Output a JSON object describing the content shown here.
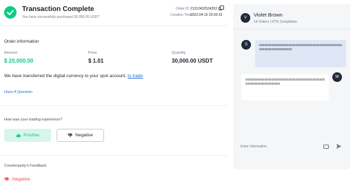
{
  "header": {
    "title": "Transaction Complete",
    "subtitle": "You have successfully purchased 30,000.00 USDT",
    "order_id_label": "Order ID",
    "order_id": "21312432524353",
    "creation_time_label": "Creation Time",
    "creation_time": "2022-04-15 20:30:15"
  },
  "order": {
    "section_title": "Order information",
    "amount_label": "Amount",
    "amount": "$ 20,000.00",
    "price_label": "Price",
    "price": "$ 1.01",
    "quantity_label": "Quantity",
    "quantity": "30,000.00 USDT",
    "transfer_text": "We have transferred the digital currency to your spot account,",
    "transfer_link": "to trade",
    "question_link": "Have A Question"
  },
  "feedback": {
    "question": "How was your trading experience?",
    "positive_label": "Positive",
    "negative_label": "Negative",
    "counterparty_title": "Counterparty's Feedback",
    "counterparty_value": "Negative"
  },
  "chat": {
    "avatar_letter": "V",
    "name": "Violet Brown",
    "stats": "14 Orders  |  97% Completion",
    "incoming_avatar": "S",
    "incoming_text": "xxxxxxxxxxxxxxxxxxxxxxxxxxxxxxxxxxxxxxxxxxxxxxxxxxxxxxxxxxxxxxxxxxx",
    "outgoing_avatar": "W",
    "outgoing_text": "xxxxxxxxxxxxxxxxxxxxxxxxxxxxxxxxxxxxxxxxxxxxxxxxxxxxxxxxxxxxxxxxxx",
    "input_placeholder": "Enter information"
  },
  "colors": {
    "success": "#0ecb81",
    "danger": "#f6465d",
    "link": "#1f6fdb",
    "avatar": "#1e2a3a"
  }
}
